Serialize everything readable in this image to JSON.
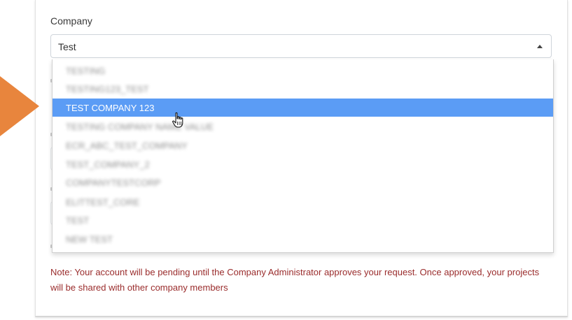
{
  "form": {
    "company_label": "Company",
    "company_value": "Test"
  },
  "dropdown": {
    "options": [
      {
        "label": "TESTING"
      },
      {
        "label": "TESTING123_TEST"
      },
      {
        "label": "TEST COMPANY 123"
      },
      {
        "label": "TESTING COMPANY NAME VALUE"
      },
      {
        "label": "ECR_ABC_TEST_COMPANY"
      },
      {
        "label": "TEST_COMPANY_2"
      },
      {
        "label": "COMPANYTESTCORP"
      },
      {
        "label": "ELITTEST_CORE"
      },
      {
        "label": "TEST"
      },
      {
        "label": "NEW TEST"
      }
    ],
    "selected_index": 2
  },
  "note": {
    "text": "Note: Your account will be pending until the Company Administrator approves your request. Once approved, your projects will be shared with other company members"
  },
  "colors": {
    "highlight": "#5b9cf5",
    "arrow": "#e8853d",
    "note_text": "#9a2c2c"
  },
  "icons": {
    "cursor": "hand-pointer-icon",
    "caret": "caret-up-icon",
    "arrow": "orange-pointer-arrow"
  }
}
